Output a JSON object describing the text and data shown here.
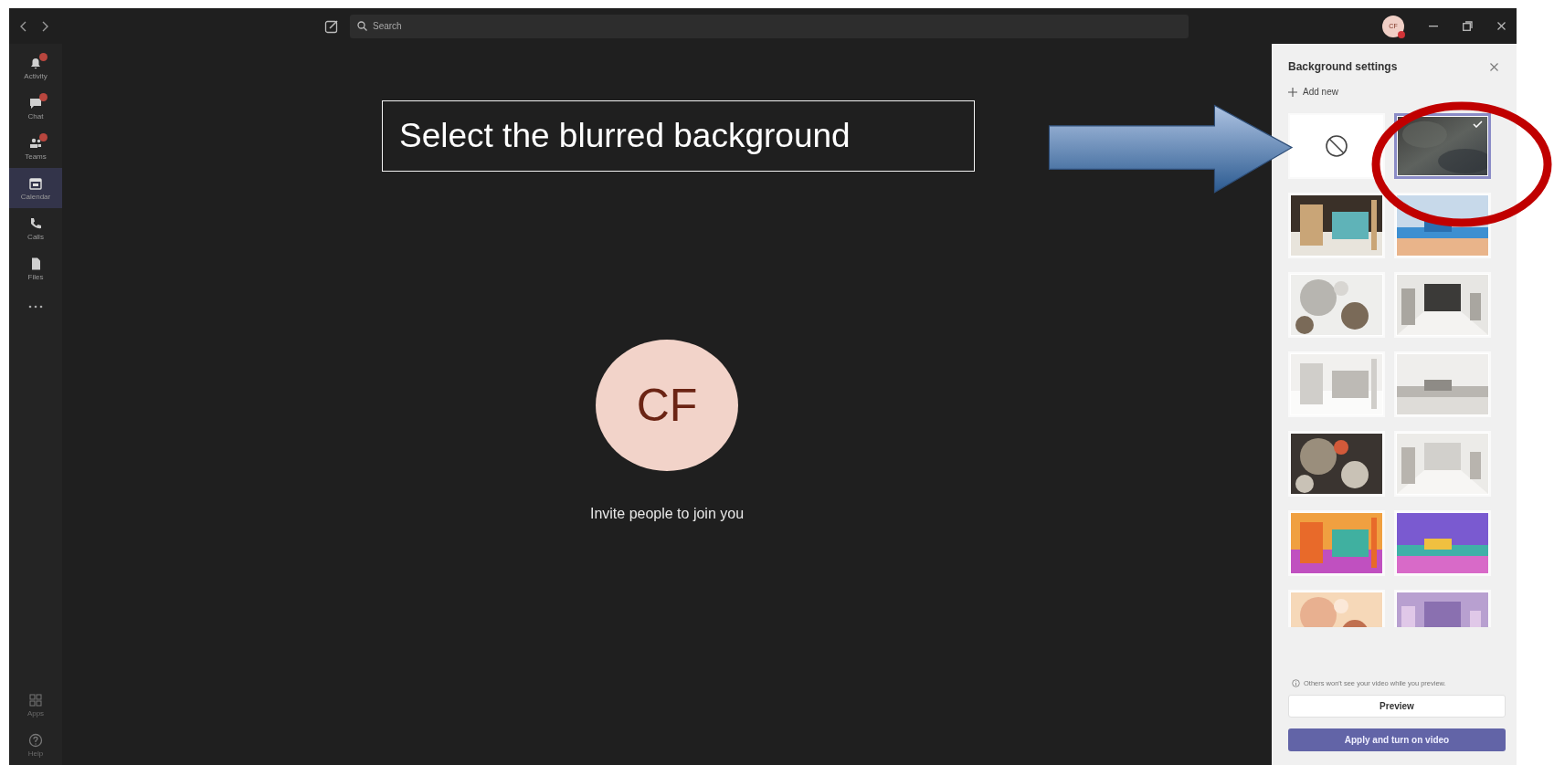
{
  "title_bar": {
    "search_placeholder": "Search",
    "avatar_initials": "CF"
  },
  "rail": {
    "items": [
      {
        "label": "Activity",
        "selected": false,
        "badge": true
      },
      {
        "label": "Chat",
        "selected": false,
        "badge": true
      },
      {
        "label": "Teams",
        "selected": false,
        "badge": true
      },
      {
        "label": "Calendar",
        "selected": true,
        "badge": false
      },
      {
        "label": "Calls",
        "selected": false,
        "badge": false
      },
      {
        "label": "Files",
        "selected": false,
        "badge": false
      }
    ],
    "bottom_items": [
      {
        "label": "Apps",
        "selected": false
      },
      {
        "label": "Help",
        "selected": false
      }
    ]
  },
  "meeting": {
    "initials": "CF",
    "message": "Invite people to join you"
  },
  "annotation": {
    "callout": "Select the blurred background"
  },
  "background_settings": {
    "title": "Background settings",
    "add_label": "Add new",
    "options": [
      {
        "kind": "none",
        "selected": false
      },
      {
        "kind": "blur",
        "selected": true
      },
      {
        "kind": "picture",
        "selected": false
      },
      {
        "kind": "picture",
        "selected": false
      },
      {
        "kind": "picture",
        "selected": false
      },
      {
        "kind": "picture",
        "selected": false
      },
      {
        "kind": "picture",
        "selected": false
      },
      {
        "kind": "picture",
        "selected": false
      },
      {
        "kind": "picture",
        "selected": false
      },
      {
        "kind": "picture",
        "selected": false
      },
      {
        "kind": "picture",
        "selected": false
      },
      {
        "kind": "picture",
        "selected": false
      },
      {
        "kind": "picture",
        "selected": false
      },
      {
        "kind": "picture",
        "selected": false
      }
    ],
    "info": "Others won't see your video while you preview.",
    "preview_button": "Preview",
    "apply_button": "Apply and turn on video"
  }
}
